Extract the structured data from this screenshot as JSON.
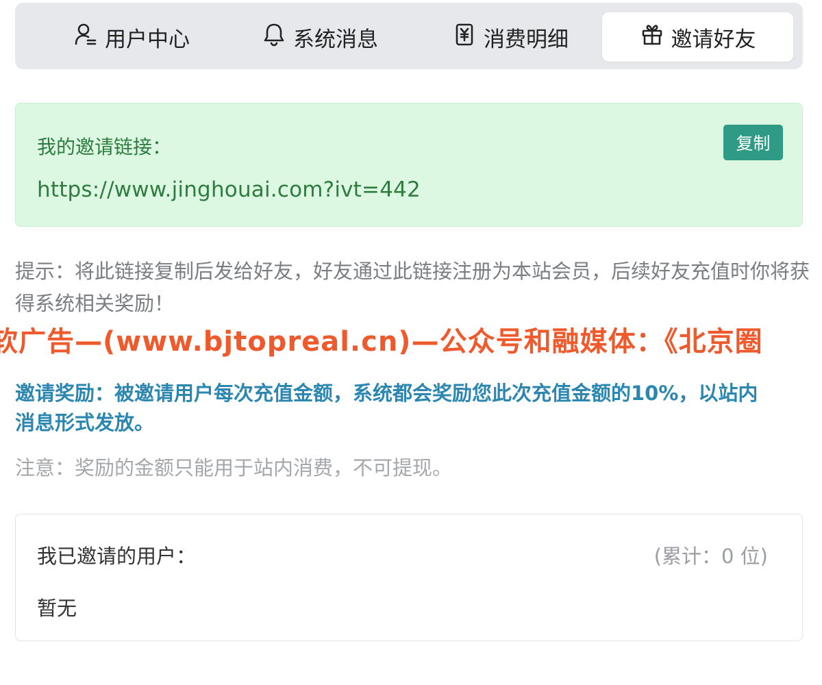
{
  "tabs": [
    {
      "label": "用户中心",
      "icon": "user-icon"
    },
    {
      "label": "系统消息",
      "icon": "bell-icon"
    },
    {
      "label": "消费明细",
      "icon": "receipt-yen-icon"
    },
    {
      "label": "邀请好友",
      "icon": "gift-icon",
      "active": true
    }
  ],
  "invite": {
    "label": "我的邀请链接：",
    "link": "https://www.jinghouai.com?ivt=442",
    "copy_label": "复制"
  },
  "tip": "提示：将此链接复制后发给好友，好友通过此链接注册为本站会员，后续好友充值时你将获得系统相关奖励！",
  "watermark": "软广告—(www.bjtopreal.cn)—公众号和融媒体：《北京圈",
  "reward": "邀请奖励：被邀请用户每次充值金额，系统都会奖励您此次充值金额的10%，以站内消息形式发放。",
  "note": "注意：奖励的金额只能用于站内消费，不可提现。",
  "invited": {
    "title": "我已邀请的用户：",
    "count_text": "(累计：0 位)",
    "empty_text": "暂无"
  },
  "colors": {
    "tab_bar_bg": "#e7e8eb",
    "invite_bg": "#dcf8e3",
    "invite_text": "#2e7c3e",
    "copy_button": "#2f9a85",
    "reward_text": "#2b86b0",
    "watermark_text": "#ef5a2d"
  }
}
